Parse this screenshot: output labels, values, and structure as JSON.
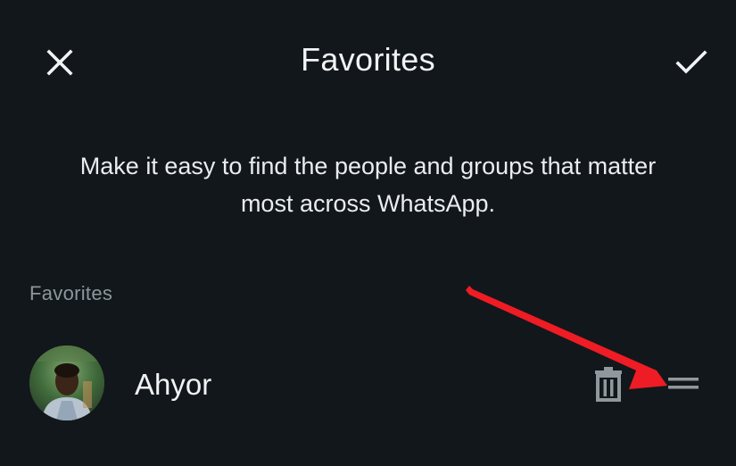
{
  "header": {
    "title": "Favorites",
    "close_icon": "close-icon",
    "confirm_icon": "check-icon"
  },
  "description": "Make it easy to find the people and groups that matter most across WhatsApp.",
  "favorites_section": {
    "header": "Favorites",
    "items": [
      {
        "name": "Ahyor",
        "avatar_icon": "contact-photo",
        "delete_icon": "trash-icon",
        "drag_icon": "drag-handle-icon"
      }
    ]
  },
  "colors": {
    "background": "#12171b",
    "primary_text": "#e9edef",
    "secondary_text": "#8c969c",
    "icon": "#8f989d",
    "annotation_arrow": "#ee1c24"
  }
}
